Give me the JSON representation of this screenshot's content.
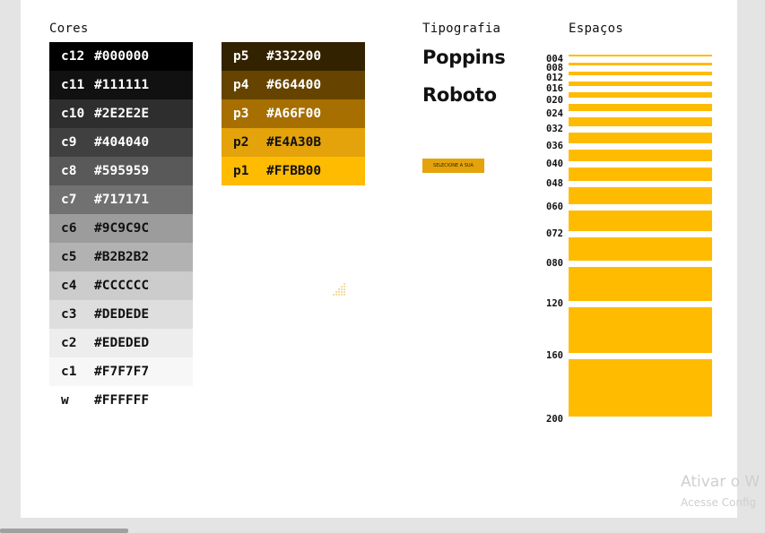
{
  "headings": {
    "cores": "Cores",
    "tipografia": "Tipografia",
    "espacos": "Espaços"
  },
  "grays": [
    {
      "code": "c12",
      "hex": "#000000"
    },
    {
      "code": "c11",
      "hex": "#111111"
    },
    {
      "code": "c10",
      "hex": "#2E2E2E"
    },
    {
      "code": "c9",
      "hex": "#404040"
    },
    {
      "code": "c8",
      "hex": "#595959"
    },
    {
      "code": "c7",
      "hex": "#717171"
    },
    {
      "code": "c6",
      "hex": "#9C9C9C"
    },
    {
      "code": "c5",
      "hex": "#B2B2B2"
    },
    {
      "code": "c4",
      "hex": "#CCCCCC"
    },
    {
      "code": "c3",
      "hex": "#DEDEDE"
    },
    {
      "code": "c2",
      "hex": "#EDEDED"
    },
    {
      "code": "c1",
      "hex": "#F7F7F7"
    },
    {
      "code": "w",
      "hex": "#FFFFFF"
    }
  ],
  "primaries": [
    {
      "code": "p5",
      "hex": "#332200"
    },
    {
      "code": "p4",
      "hex": "#664400"
    },
    {
      "code": "p3",
      "hex": "#A66F00"
    },
    {
      "code": "p2",
      "hex": "#E4A30B"
    },
    {
      "code": "p1",
      "hex": "#FFBB00"
    }
  ],
  "typography": {
    "font1": "Poppins",
    "font2": "Roboto",
    "button_label": "SELECIONE A SUA"
  },
  "spaces": [
    {
      "label": "004",
      "value": 4
    },
    {
      "label": "008",
      "value": 8
    },
    {
      "label": "012",
      "value": 12
    },
    {
      "label": "016",
      "value": 16
    },
    {
      "label": "020",
      "value": 20
    },
    {
      "label": "024",
      "value": 24
    },
    {
      "label": "032",
      "value": 32
    },
    {
      "label": "036",
      "value": 36
    },
    {
      "label": "040",
      "value": 40
    },
    {
      "label": "048",
      "value": 48
    },
    {
      "label": "060",
      "value": 60
    },
    {
      "label": "072",
      "value": 72
    },
    {
      "label": "080",
      "value": 80
    },
    {
      "label": "120",
      "value": 120
    },
    {
      "label": "160",
      "value": 160
    },
    {
      "label": "200",
      "value": 200
    }
  ],
  "watermark": {
    "line1": "Ativar o W",
    "line2": "Acesse Config"
  },
  "icons": {
    "dots": "dot-grid-icon"
  },
  "accent": "#FFBB00"
}
